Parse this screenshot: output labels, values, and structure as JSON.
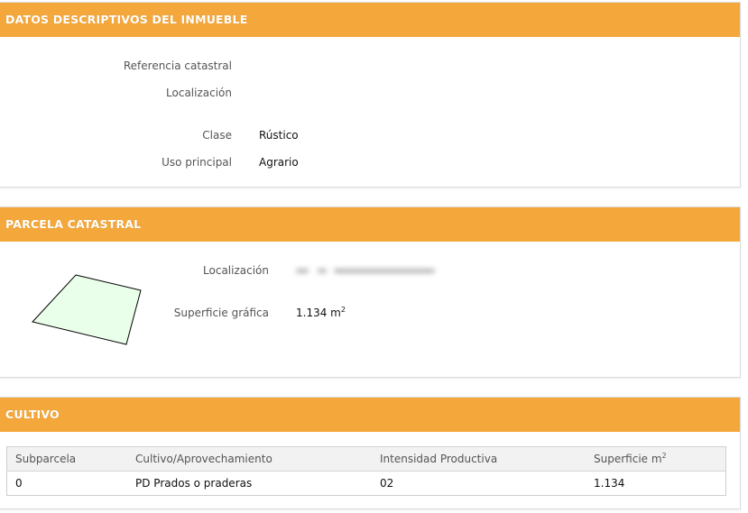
{
  "descriptive": {
    "title": "DATOS DESCRIPTIVOS DEL INMUEBLE",
    "fields": [
      {
        "label": "Referencia catastral",
        "value": ""
      },
      {
        "label": "Localización",
        "value": ""
      },
      {
        "label": "Clase",
        "value": "Rústico"
      },
      {
        "label": "Uso principal",
        "value": "Agrario"
      }
    ]
  },
  "parcel": {
    "title": "PARCELA CATASTRAL",
    "location_label": "Localización",
    "surface_label": "Superficie gráfica",
    "surface_value": "1.134 m",
    "surface_unit_sup": "2",
    "shape_fill": "#eaffea"
  },
  "crop": {
    "title": "CULTIVO",
    "headers": [
      "Subparcela",
      "Cultivo/Aprovechamiento",
      "Intensidad Productiva",
      "Superficie m"
    ],
    "header_sup": "2",
    "rows": [
      [
        "0",
        "PD Prados o praderas",
        "02",
        "1.134"
      ]
    ]
  },
  "colors": {
    "header_bg": "#f4a83c",
    "header_text": "#ffffff"
  }
}
